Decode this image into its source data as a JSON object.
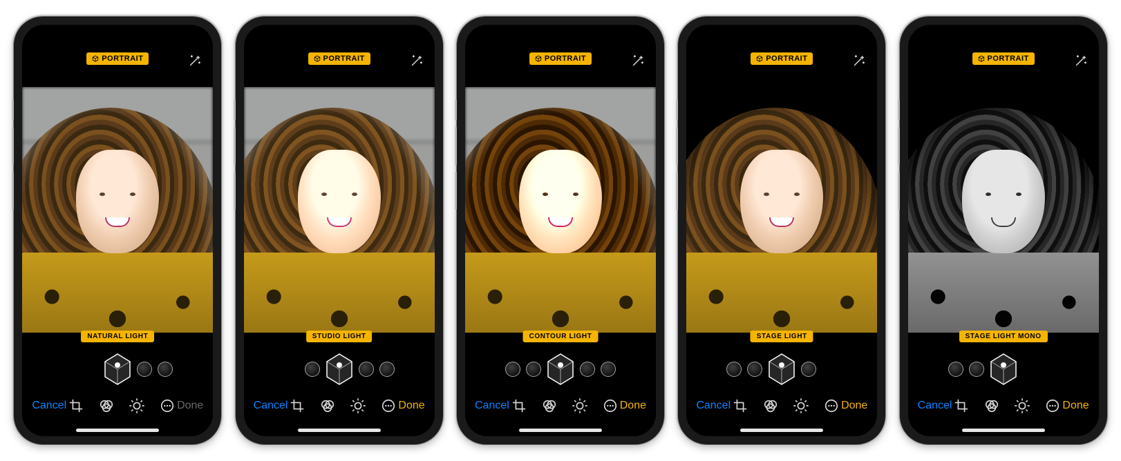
{
  "badge_label": "PORTRAIT",
  "toolbar": {
    "cancel_label": "Cancel",
    "done_label": "Done",
    "icons": [
      "crop",
      "filters",
      "adjust",
      "more"
    ]
  },
  "colors": {
    "accent": "#F5B400",
    "link_blue": "#0A84FF",
    "disabled": "#6a6a6a"
  },
  "lighting_options": [
    "NATURAL LIGHT",
    "STUDIO LIGHT",
    "CONTOUR LIGHT",
    "STAGE LIGHT",
    "STAGE LIGHT MONO"
  ],
  "phones": [
    {
      "light_label": "NATURAL LIGHT",
      "selected_index": 0,
      "done_enabled": false,
      "fx": "fx-natural"
    },
    {
      "light_label": "STUDIO LIGHT",
      "selected_index": 1,
      "done_enabled": true,
      "fx": "fx-studio"
    },
    {
      "light_label": "CONTOUR LIGHT",
      "selected_index": 2,
      "done_enabled": true,
      "fx": "fx-contour"
    },
    {
      "light_label": "STAGE LIGHT",
      "selected_index": 3,
      "done_enabled": true,
      "fx": "fx-stage"
    },
    {
      "light_label": "STAGE LIGHT MONO",
      "selected_index": 4,
      "done_enabled": true,
      "fx": "fx-mono"
    }
  ]
}
